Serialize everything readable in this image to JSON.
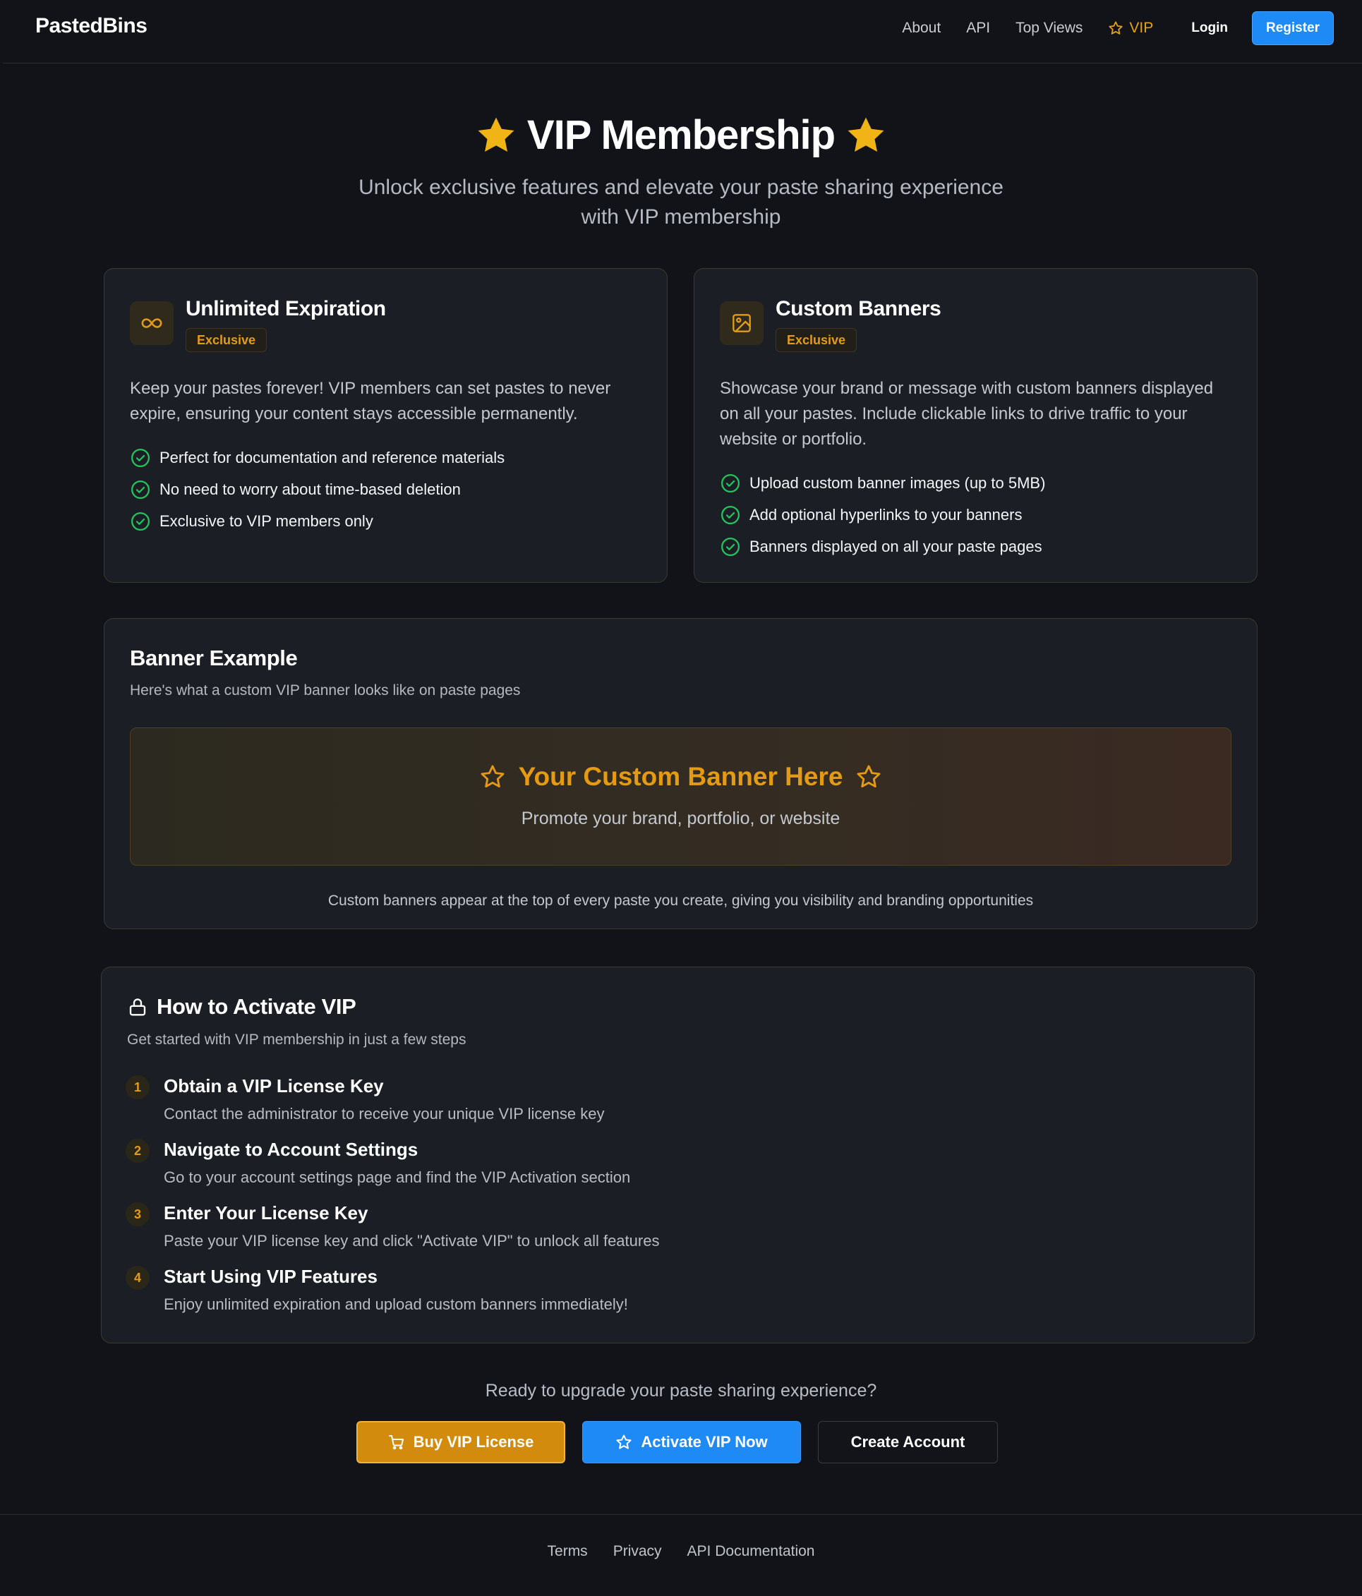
{
  "nav": {
    "brand": "PastedBins",
    "links": [
      "About",
      "API",
      "Top Views"
    ],
    "vip": "VIP",
    "login": "Login",
    "register": "Register"
  },
  "hero": {
    "title": "VIP Membership",
    "subtitle_line1": "Unlock exclusive features and elevate your paste sharing experience",
    "subtitle_line2": "with VIP membership"
  },
  "features": [
    {
      "title": "Unlimited Expiration",
      "badge": "Exclusive",
      "icon": "infinity-icon",
      "desc": "Keep your pastes forever! VIP members can set pastes to never expire, ensuring your content stays accessible permanently.",
      "items": [
        "Perfect for documentation and reference materials",
        "No need to worry about time-based deletion",
        "Exclusive to VIP members only"
      ]
    },
    {
      "title": "Custom Banners",
      "badge": "Exclusive",
      "icon": "image-icon",
      "desc": "Showcase your brand or message with custom banners displayed on all your pastes. Include clickable links to drive traffic to your website or portfolio.",
      "items": [
        "Upload custom banner images (up to 5MB)",
        "Add optional hyperlinks to your banners",
        "Banners displayed on all your paste pages"
      ]
    }
  ],
  "banner_example": {
    "title": "Banner Example",
    "subtitle": "Here's what a custom VIP banner looks like on paste pages",
    "banner_title": "Your Custom Banner Here",
    "banner_sub": "Promote your brand, portfolio, or website",
    "note": "Custom banners appear at the top of every paste you create, giving you visibility and branding opportunities"
  },
  "activate": {
    "title": "How to Activate VIP",
    "subtitle": "Get started with VIP membership in just a few steps",
    "steps": [
      {
        "num": "1",
        "title": "Obtain a VIP License Key",
        "desc": "Contact the administrator to receive your unique VIP license key"
      },
      {
        "num": "2",
        "title": "Navigate to Account Settings",
        "desc": "Go to your account settings page and find the VIP Activation section"
      },
      {
        "num": "3",
        "title": "Enter Your License Key",
        "desc": "Paste your VIP license key and click \"Activate VIP\" to unlock all features"
      },
      {
        "num": "4",
        "title": "Start Using VIP Features",
        "desc": "Enjoy unlimited expiration and upload custom banners immediately!"
      }
    ]
  },
  "cta": {
    "text": "Ready to upgrade your paste sharing experience?",
    "buy": "Buy VIP License",
    "activate": "Activate VIP Now",
    "create": "Create Account"
  },
  "footer": {
    "links": [
      "Terms",
      "Privacy",
      "API Documentation"
    ]
  },
  "colors": {
    "background": "#111318",
    "card": "#1b1e25",
    "accent_gold": "#e49b17",
    "accent_blue": "#1e8af5",
    "check_green": "#22c55e"
  }
}
